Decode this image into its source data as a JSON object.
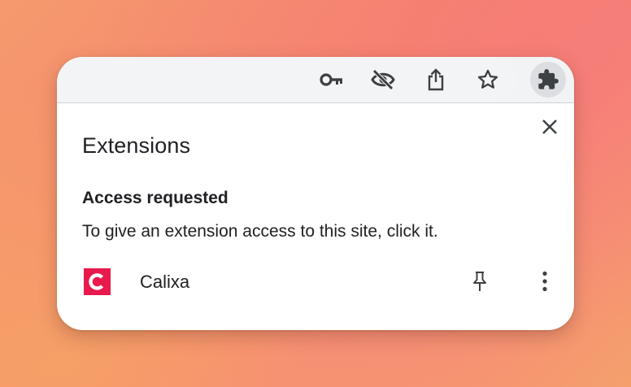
{
  "toolbar": {
    "icons": [
      "key-icon",
      "eye-off-icon",
      "share-icon",
      "star-icon",
      "puzzle-icon"
    ]
  },
  "extensions_panel": {
    "title": "Extensions",
    "close_icon": "close-icon",
    "section": {
      "heading": "Access requested",
      "description": "To give an extension access to this site, click it."
    },
    "items": [
      {
        "name": "Calixa",
        "logo_letter": "C",
        "logo_color": "#e8194c",
        "pin_icon": "pin-icon",
        "menu_icon": "more-vert-icon"
      }
    ]
  }
}
